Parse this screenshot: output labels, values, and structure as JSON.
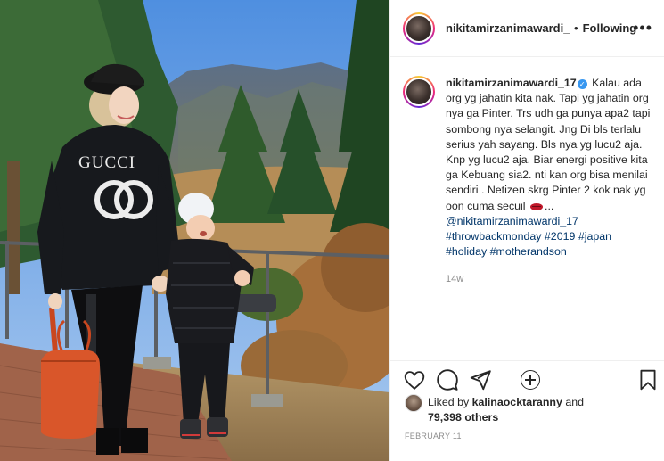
{
  "post": {
    "photo_alt": "",
    "print_text": "GUCCI"
  },
  "header": {
    "username": "nikitamirzanimawardi_17",
    "separator": "•",
    "follow_status": "Following",
    "more_icon": "more-horizontal-icon"
  },
  "caption": {
    "username": "nikitamirzanimawardi_17",
    "verified_icon": "verified-badge-icon",
    "text_before_emoji": "Kalau ada org yg jahatin kita nak. Tapi yg jahatin org nya ga Pinter. Trs udh ga punya apa2 tapi sombong nya selangit. Jng Di bls terlalu serius yah sayang. Bls nya yg lucu2 aja. Knp yg lucu2 aja. Biar energi positive kita ga Kebuang sia2. nti kan org bisa menilai sendiri . Netizen skrg Pinter 2 kok nak yg oon cuma secuil",
    "emoji": "lips-emoji",
    "text_after_emoji": "...",
    "mention": "@nikitamirzanimawardi_17",
    "hashtags": [
      "#throwbackmonday",
      "#2019",
      "#japan",
      "#holiday",
      "#motherandson"
    ],
    "time": "14w"
  },
  "load_more_icon": "plus-circle-icon",
  "actions": {
    "like_icon": "heart-icon",
    "comment_icon": "comment-icon",
    "share_icon": "share-icon",
    "save_icon": "bookmark-icon"
  },
  "likes": {
    "prefix": "Liked by",
    "user": "kalinaocktaranny",
    "conjunction": "and",
    "count": "79,398 others"
  },
  "date": "FEBRUARY 11",
  "colors": {
    "link": "#003569",
    "verified": "#3897f0",
    "muted": "#8e8e8e",
    "text": "#262626"
  }
}
